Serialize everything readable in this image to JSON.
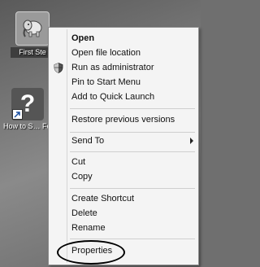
{
  "desktop": {
    "icons": [
      {
        "label": "First Ste",
        "icon": "elephant-app-icon"
      },
      {
        "label": "How to S… Feedba…",
        "icon": "help-shortcut-icon"
      }
    ]
  },
  "context_menu": {
    "items": [
      {
        "label": "Open",
        "bold": true
      },
      {
        "label": "Open file location"
      },
      {
        "label": "Run as administrator",
        "icon": "shield-icon"
      },
      {
        "label": "Pin to Start Menu"
      },
      {
        "label": "Add to Quick Launch"
      },
      {
        "label": "Restore previous versions"
      },
      {
        "label": "Send To",
        "submenu": true
      },
      {
        "label": "Cut"
      },
      {
        "label": "Copy"
      },
      {
        "label": "Create Shortcut"
      },
      {
        "label": "Delete"
      },
      {
        "label": "Rename"
      },
      {
        "label": "Properties",
        "highlighted": true
      }
    ]
  },
  "colors": {
    "menu_bg": "#f4f4f4",
    "desktop_bg": "#6f6f6f",
    "highlight_ring": "#000000"
  }
}
